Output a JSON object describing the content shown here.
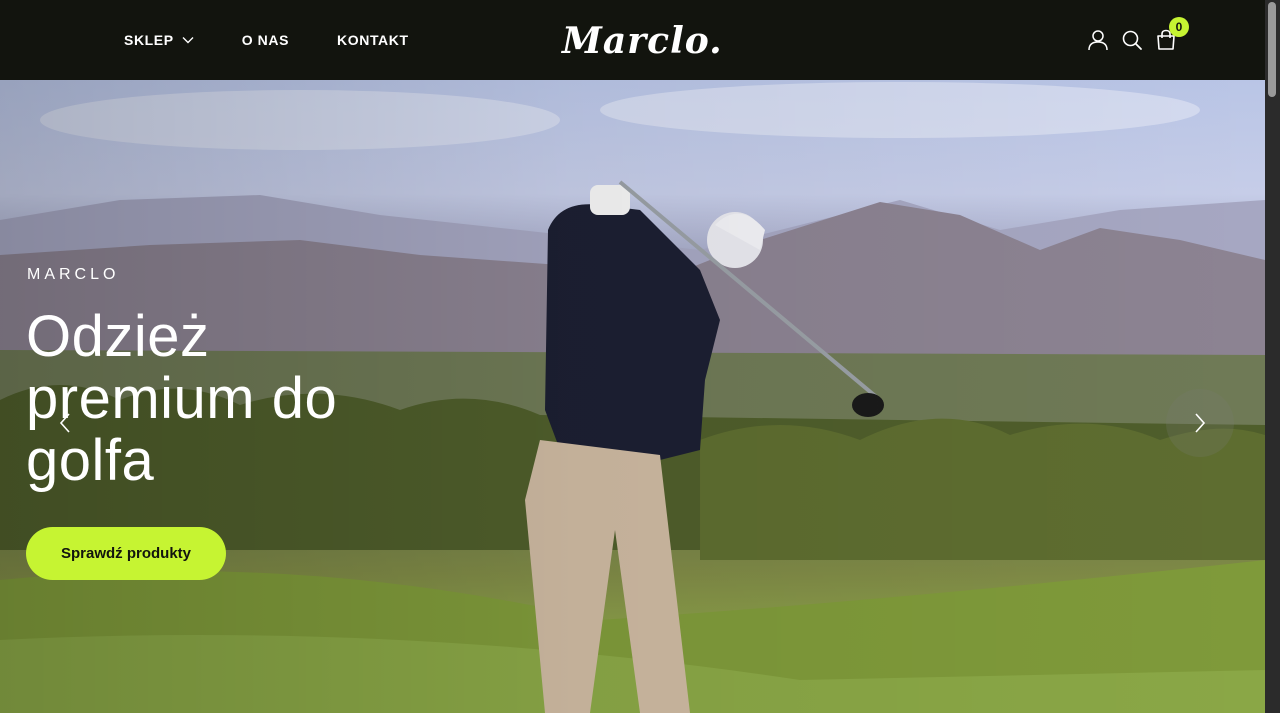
{
  "nav": {
    "items": [
      {
        "label": "SKLEP",
        "has_dropdown": true
      },
      {
        "label": "O NAS"
      },
      {
        "label": "KONTAKT"
      }
    ]
  },
  "brand": {
    "logo_text": "Marclo."
  },
  "header_icons": {
    "account": "user-icon",
    "search": "search-icon",
    "cart": "shopping-bag-icon",
    "cart_count": "0"
  },
  "hero": {
    "eyebrow": "MARCLO",
    "headline": "Odzież premium do golfa",
    "cta_label": "Sprawdź produkty",
    "prev_icon": "chevron-left-icon",
    "next_icon": "chevron-right-icon"
  },
  "colors": {
    "header_bg": "#12140e",
    "accent": "#c6f432",
    "text_light": "#ffffff"
  }
}
